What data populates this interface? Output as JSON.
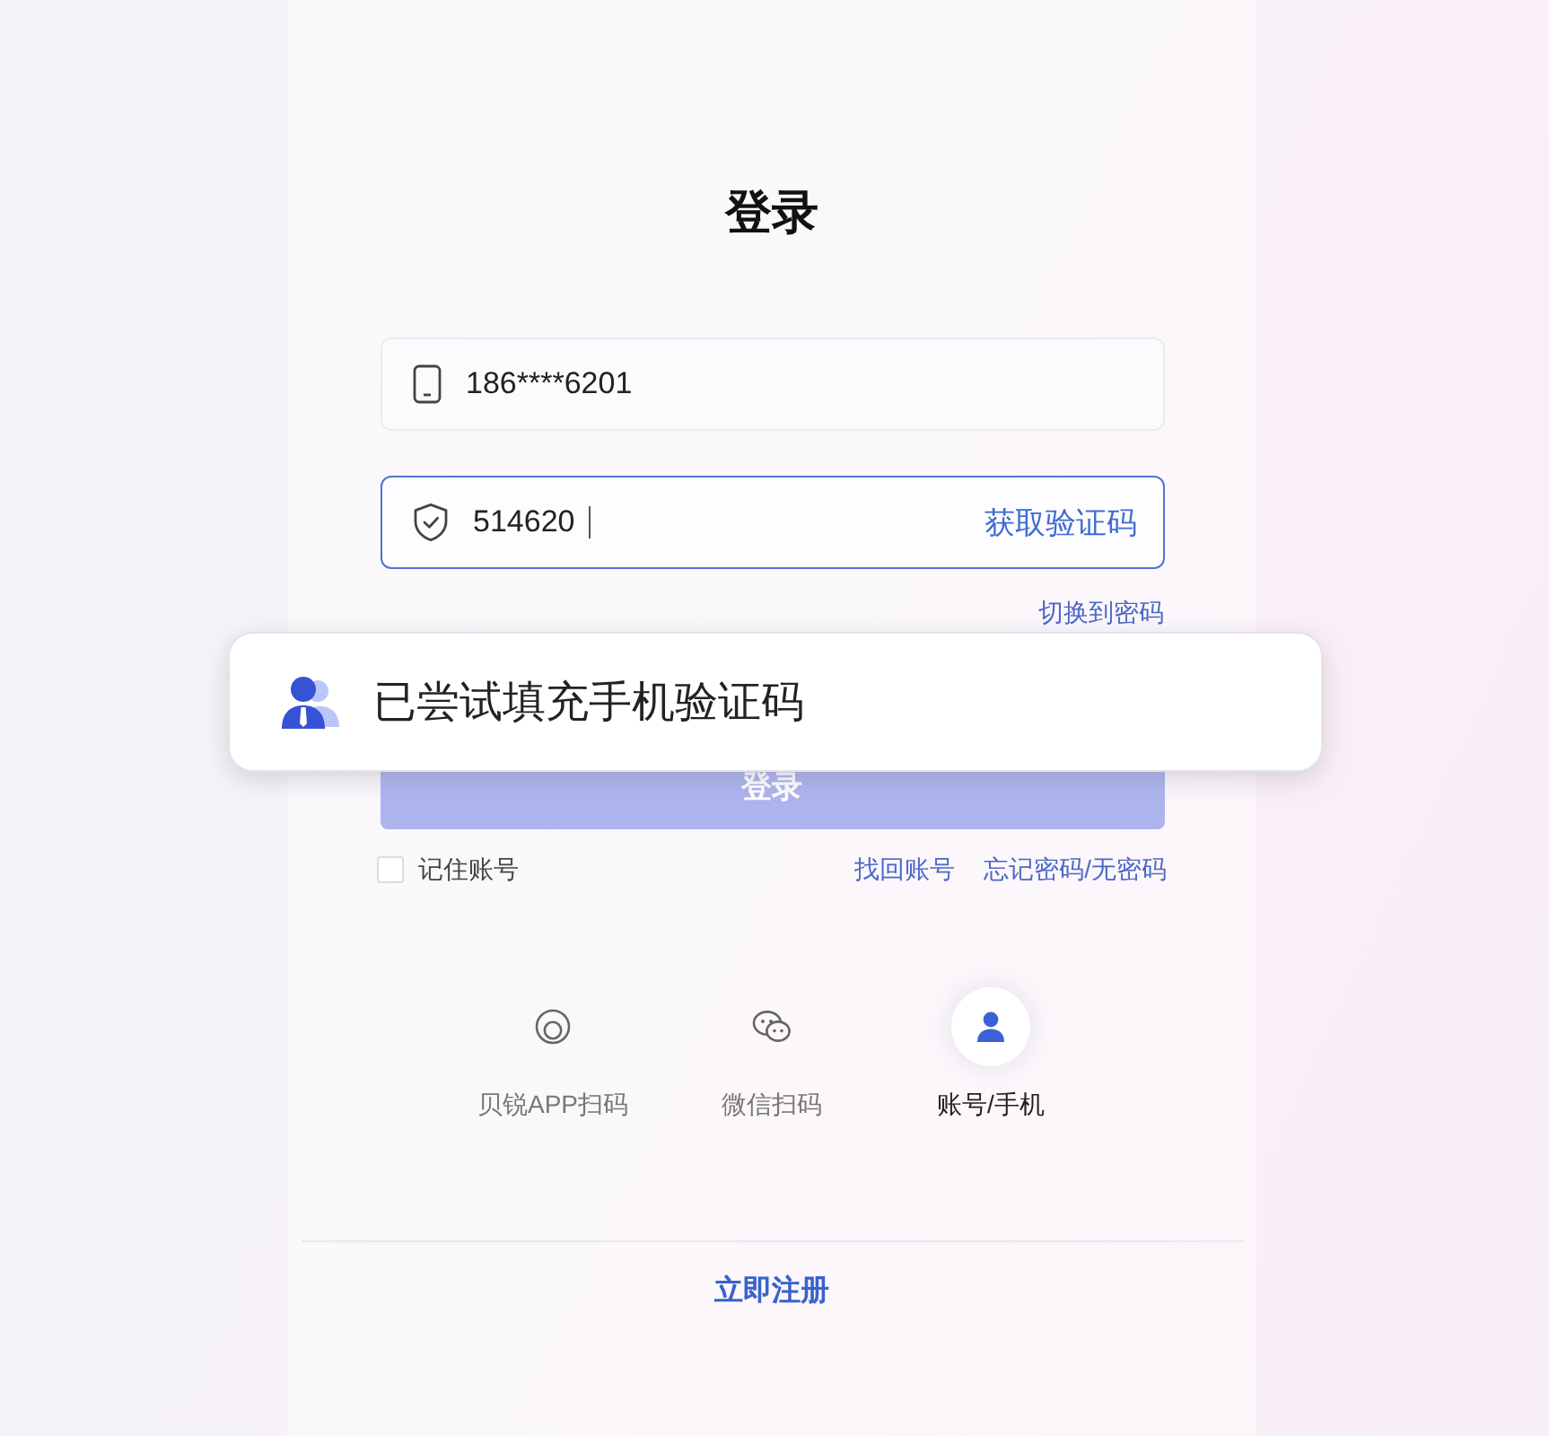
{
  "title": "登录",
  "fields": [
    {
      "kind": "phone",
      "value": "186****6201",
      "focused": false
    },
    {
      "kind": "code",
      "value": "514620",
      "focused": true,
      "action": "获取验证码"
    }
  ],
  "switch_link": "切换到密码",
  "toast": {
    "message": "已尝试填充手机验证码"
  },
  "login_button": {
    "label": "登录"
  },
  "remember": {
    "label": "记住账号",
    "checked": false
  },
  "links": [
    "找回账号",
    "忘记密码/无密码"
  ],
  "methods": [
    {
      "kind": "app_scan",
      "label": "贝锐APP扫码",
      "selected": false
    },
    {
      "kind": "wechat",
      "label": "微信扫码",
      "selected": false
    },
    {
      "kind": "account",
      "label": "账号/手机",
      "selected": true
    }
  ],
  "register_link": "立即注册"
}
